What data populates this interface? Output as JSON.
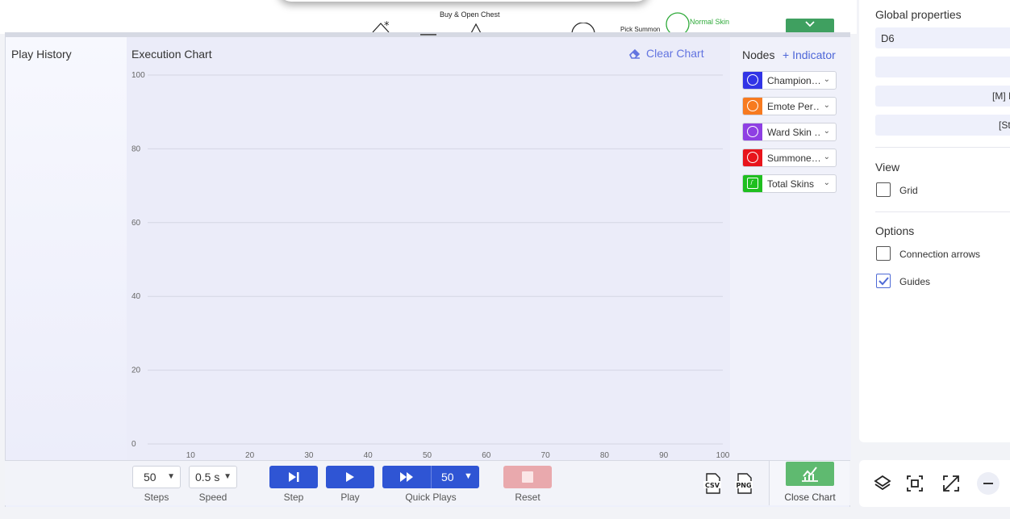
{
  "canvas_top": {
    "buy_chest_label": "Buy & Open Chest",
    "normal_skin_label": "Normal Skin",
    "pick_label": "Pick Summon"
  },
  "play_history": {
    "label": "Play History"
  },
  "execution_chart": {
    "title": "Execution Chart",
    "clear_label": "Clear Chart"
  },
  "nodes_panel": {
    "title": "Nodes",
    "add_label": "+ Indicator",
    "items": [
      {
        "label": "Champion…",
        "color": "#3134e6",
        "shape": "circle"
      },
      {
        "label": "Emote Per…",
        "color": "#f77a1f",
        "shape": "circle"
      },
      {
        "label": "Ward Skin …",
        "color": "#8e3fe3",
        "shape": "circle"
      },
      {
        "label": "Summone…",
        "color": "#e8141b",
        "shape": "circle"
      },
      {
        "label": "Total Skins",
        "color": "#1fbf1f",
        "shape": "register"
      }
    ]
  },
  "chart_data": {
    "type": "line",
    "title": "Execution Chart",
    "xlabel": "",
    "ylabel": "",
    "x_ticks": [
      10,
      20,
      30,
      40,
      50,
      60,
      70,
      80,
      90,
      100
    ],
    "y_ticks": [
      0,
      20,
      40,
      60,
      80,
      100
    ],
    "xlim": [
      0,
      100
    ],
    "ylim": [
      0,
      100
    ],
    "grid": true,
    "series": []
  },
  "controls": {
    "steps_value": "50",
    "steps_label": "Steps",
    "speed_value": "0.5 s",
    "speed_label": "Speed",
    "step_label": "Step",
    "play_label": "Play",
    "quick_plays_value": "50",
    "quick_plays_label": "Quick Plays",
    "reset_label": "Reset",
    "csv_label": "CSV",
    "png_label": "PNG",
    "close_chart_label": "Close Chart"
  },
  "right_panel": {
    "global_title": "Global properties",
    "field1_value": "D6",
    "field3_value": "[M] I",
    "field4_value": "[St",
    "view_title": "View",
    "grid_label": "Grid",
    "grid_checked": false,
    "options_title": "Options",
    "connection_arrows_label": "Connection arrows",
    "connection_arrows_checked": false,
    "guides_label": "Guides",
    "guides_checked": true
  },
  "colors": {
    "primary_button": "#2f55d4",
    "reset_button": "#e9a9ad",
    "close_chart_button": "#5fba70",
    "link": "#4d66d8"
  }
}
